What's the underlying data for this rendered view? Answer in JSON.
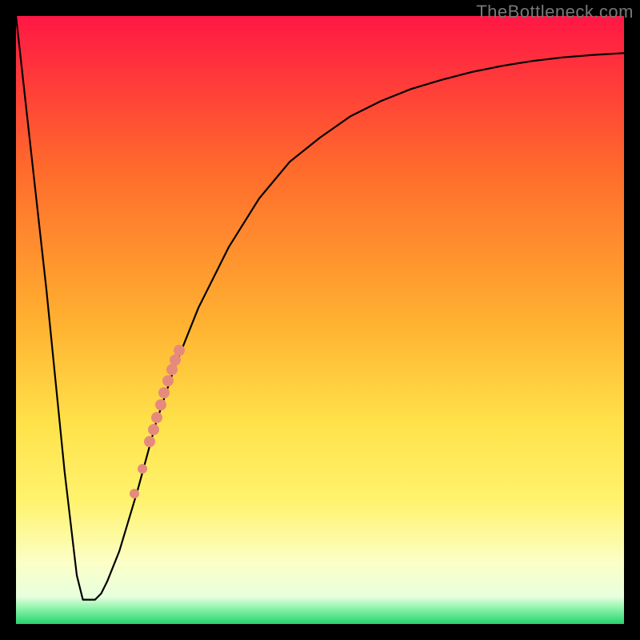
{
  "watermark": "TheBottleneck.com",
  "chart_data": {
    "type": "line",
    "title": "",
    "xlabel": "",
    "ylabel": "",
    "xlim": [
      0,
      100
    ],
    "ylim": [
      0,
      100
    ],
    "gradient_stops": [
      {
        "offset": 0,
        "color": "#ff1744"
      },
      {
        "offset": 0.25,
        "color": "#ff6a2c"
      },
      {
        "offset": 0.5,
        "color": "#ffb030"
      },
      {
        "offset": 0.67,
        "color": "#ffe24a"
      },
      {
        "offset": 0.8,
        "color": "#fff36e"
      },
      {
        "offset": 0.9,
        "color": "#fcffc8"
      },
      {
        "offset": 0.955,
        "color": "#e7ffdd"
      },
      {
        "offset": 0.975,
        "color": "#8bf3a8"
      },
      {
        "offset": 1.0,
        "color": "#26d36e"
      }
    ],
    "series": [
      {
        "name": "bottleneck-curve",
        "x": [
          0,
          5,
          8,
          10,
          11,
          12,
          13,
          14,
          15,
          17,
          20,
          23,
          26,
          30,
          35,
          40,
          45,
          50,
          55,
          60,
          65,
          70,
          75,
          80,
          85,
          90,
          95,
          100
        ],
        "y": [
          100,
          55,
          25,
          8,
          4,
          4,
          4,
          5,
          7,
          12,
          22,
          33,
          42,
          52,
          62,
          70,
          76,
          80,
          83.5,
          86,
          88,
          89.5,
          90.8,
          91.8,
          92.6,
          93.2,
          93.6,
          93.9
        ]
      }
    ],
    "highlight_points": {
      "name": "highlighted-segment",
      "color": "#e68a7e",
      "points": [
        {
          "x": 19.5,
          "y": 21.5,
          "size": "small"
        },
        {
          "x": 20.8,
          "y": 25.5,
          "size": "small"
        },
        {
          "x": 22.0,
          "y": 30
        },
        {
          "x": 22.6,
          "y": 32
        },
        {
          "x": 23.2,
          "y": 34
        },
        {
          "x": 23.8,
          "y": 36
        },
        {
          "x": 24.4,
          "y": 38
        },
        {
          "x": 25.0,
          "y": 40
        },
        {
          "x": 25.6,
          "y": 41.8
        },
        {
          "x": 26.2,
          "y": 43.4
        },
        {
          "x": 26.8,
          "y": 45
        }
      ]
    }
  }
}
